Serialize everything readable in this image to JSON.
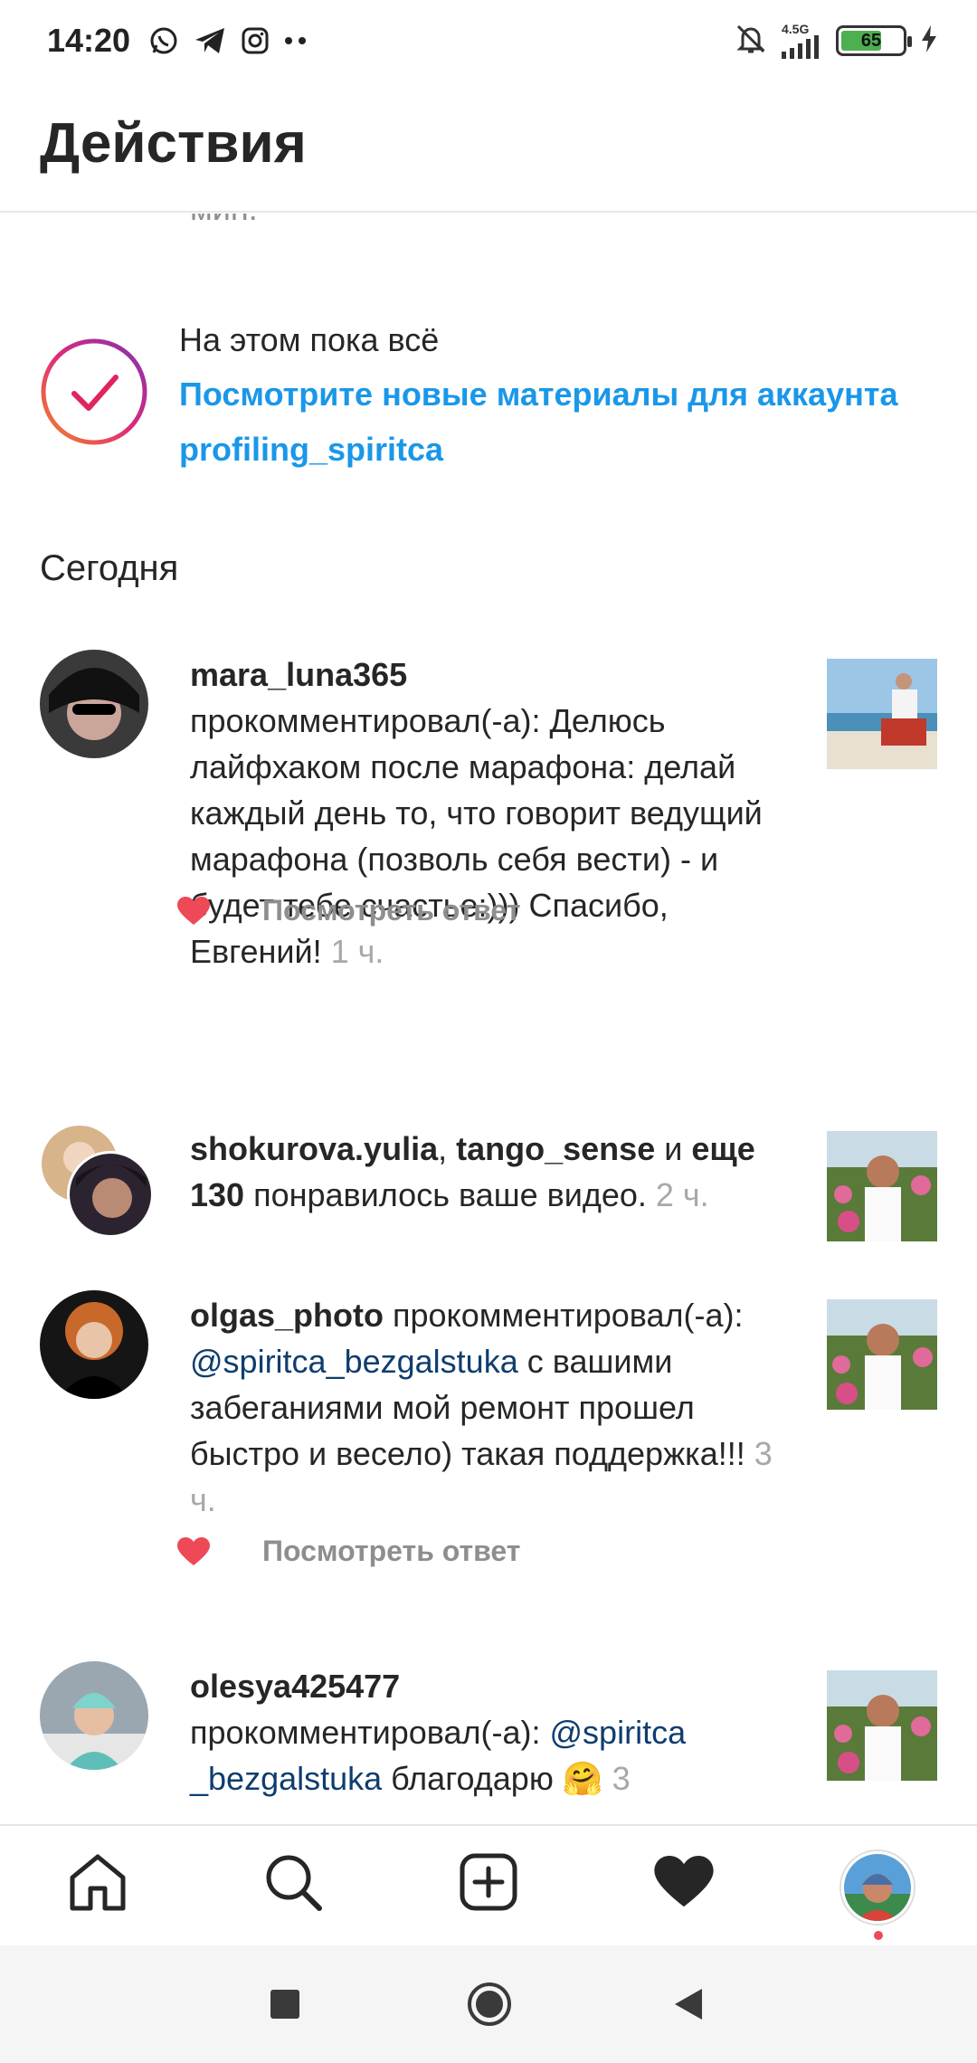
{
  "status_bar": {
    "time": "14:20",
    "network": "4.5G",
    "battery": "65",
    "app_icons": [
      "whatsapp-icon",
      "telegram-icon",
      "instagram-icon",
      "more-dots-icon"
    ],
    "right_icons": [
      "mute-bell-icon",
      "signal-icon",
      "battery-icon",
      "charging-icon"
    ]
  },
  "header": {
    "title": "Действия"
  },
  "partial_top": "мин.",
  "all_caught_up": {
    "title": "На этом пока всё",
    "link": "Посмотрите новые материалы для аккаунта profiling_spiritca"
  },
  "section": {
    "title": "Сегодня"
  },
  "notifications": [
    {
      "username": "mara_luna365",
      "text": "прокомментировал(-а): Делюсь лайфхаком после марафона: делай каждый день то, что говорит ведущий марафона (позволь себя вести) - и будет тебе счастье:))) Спасибо, Евгений!",
      "time": "1 ч.",
      "reply_label": "Посмотреть ответ"
    },
    {
      "user1": "shokurova.yulia",
      "sep1": ",",
      "user2": "tango_sense",
      "conj": "и",
      "more": "еще 130",
      "text": "понравилось ваше видео.",
      "time": "2 ч."
    },
    {
      "username": "olgas_photo",
      "action": "прокомментировал(-а):",
      "mention": "@spiritca_bezgalstuka",
      "text": "с вашими забеганиями мой ремонт прошел быстро и весело) такая поддержка!!!",
      "time": "3 ч.",
      "reply_label": "Посмотреть ответ"
    },
    {
      "username": "olesya425477",
      "action": "прокомментировал(-а):",
      "mention": "@spiritca _bezgalstuka",
      "text": "благодарю 🤗",
      "time": "3"
    }
  ],
  "tabbar": {
    "items": [
      "home-icon",
      "search-icon",
      "add-post-icon",
      "activity-heart-icon",
      "profile-avatar"
    ]
  },
  "colors": {
    "link_blue": "#1a97e8",
    "mention_blue": "#0f3d6e",
    "heart_red": "#ed4956",
    "muted_gray": "#8e8e8e"
  }
}
